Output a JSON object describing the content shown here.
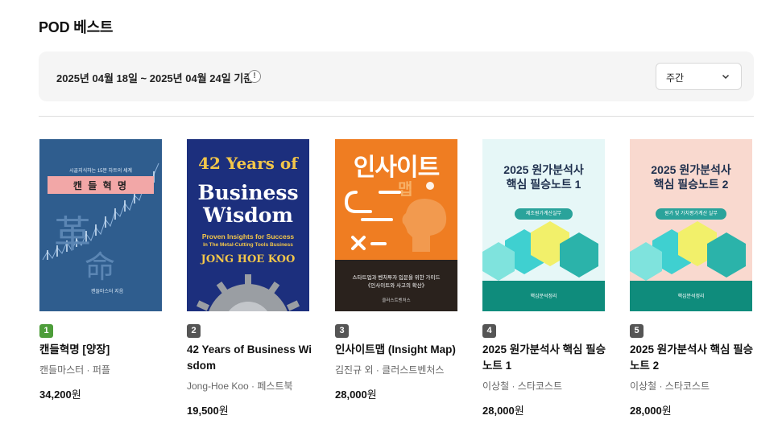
{
  "section": {
    "title": "POD 베스트"
  },
  "period": {
    "text": "2025년 04월 18일 ~ 2025년 04월 24일 기준",
    "info_icon": "info-icon",
    "select_value": "주간"
  },
  "colors": {
    "rank_first": "#4d9d3a",
    "rank_default": "#555555",
    "bar_bg": "#f5f5f5"
  },
  "books": [
    {
      "rank": "1",
      "title": "캔들혁명 [양장]",
      "meta": "캔들마스터 · 퍼플",
      "price": "34,200",
      "currency": "원",
      "cover": {
        "top": "시골지식하는 15분 차트의 세계",
        "band": "캔 들 혁 명",
        "hanja1": "革",
        "hanja2": "命",
        "author": "캔들마스터 지음"
      }
    },
    {
      "rank": "2",
      "title": "42 Years of Business Wisdom",
      "meta": "Jong-Hoe Koo · 페스트북",
      "price": "19,500",
      "currency": "원",
      "cover": {
        "line1": "42 Years of",
        "line2": "Business",
        "line3": "Wisdom",
        "sub1": "Proven Insights for Success",
        "sub2": "In The Metal-Cutting Tools Business",
        "author": "JONG HOE KOO"
      }
    },
    {
      "rank": "3",
      "title": "인사이트맵 (Insight Map)",
      "meta": "김진규 외 · 클러스트벤처스",
      "price": "28,000",
      "currency": "원",
      "cover": {
        "title": "인사이트",
        "title2": "맵",
        "sub": "스타트업과 벤처투자 입문을 위한 가이드",
        "sub2": "《인사이트와 사고의 확산》",
        "publisher": "클러스트벤처스"
      }
    },
    {
      "rank": "4",
      "title": "2025 원가분석사 핵심 필승노트 1",
      "meta": "이상철 · 스타코스트",
      "price": "28,000",
      "currency": "원",
      "cover": {
        "title1": "2025 원가분석사",
        "title2": "핵심 필승노트 1",
        "tag": "제조원가계산실무",
        "footer": "핵심분석정리"
      }
    },
    {
      "rank": "5",
      "title": "2025 원가분석사 핵심 필승노트 2",
      "meta": "이상철 · 스타코스트",
      "price": "28,000",
      "currency": "원",
      "cover": {
        "title1": "2025 원가분석사",
        "title2": "핵심 필승노트 2",
        "tag": "원가 및 가치평가계산 실무",
        "footer": "핵심분석정리"
      }
    }
  ]
}
